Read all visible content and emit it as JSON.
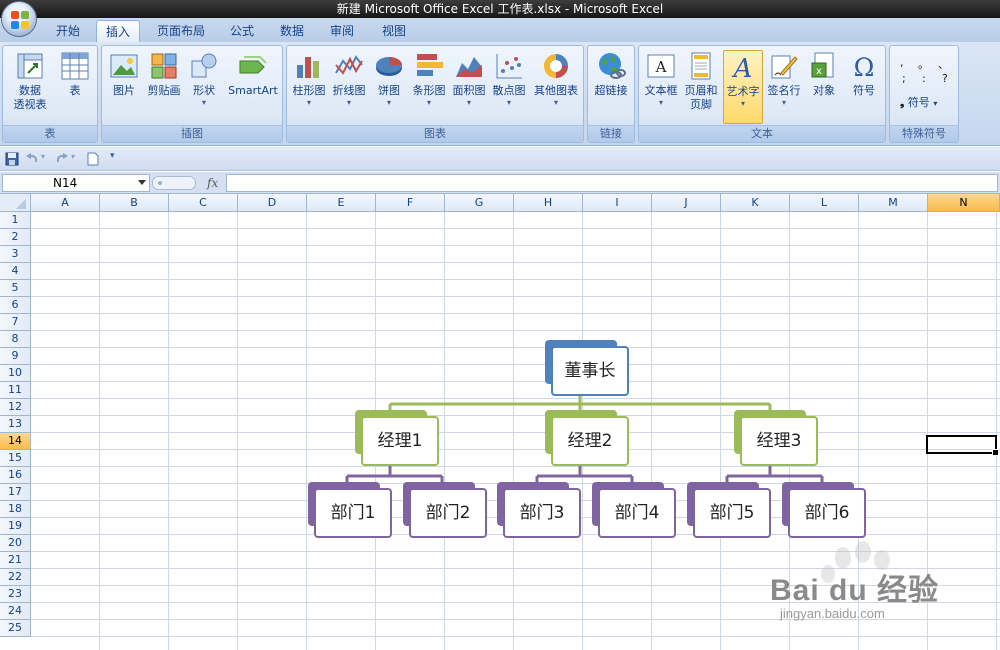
{
  "window": {
    "title": "新建 Microsoft Office Excel 工作表.xlsx - Microsoft Excel"
  },
  "tabs": [
    {
      "label": "开始",
      "active": false
    },
    {
      "label": "插入",
      "active": true
    },
    {
      "label": "页面布局",
      "active": false
    },
    {
      "label": "公式",
      "active": false
    },
    {
      "label": "数据",
      "active": false
    },
    {
      "label": "审阅",
      "active": false
    },
    {
      "label": "视图",
      "active": false
    }
  ],
  "ribbon": {
    "groups": {
      "tables": "表",
      "illustrations": "插图",
      "charts": "图表",
      "links": "链接",
      "text": "文本",
      "symbols": "特殊符号"
    },
    "buttons": {
      "pivot_line1": "数据",
      "pivot_line2": "透视表",
      "table": "表",
      "picture": "图片",
      "clipart": "剪贴画",
      "shapes": "形状",
      "smartart": "SmartArt",
      "column": "柱形图",
      "line": "折线图",
      "pie": "饼图",
      "bar": "条形图",
      "area": "面积图",
      "scatter": "散点图",
      "other_charts": "其他图表",
      "hyperlink": "超链接",
      "textbox": "文本框",
      "header_line1": "页眉和",
      "header_line2": "页脚",
      "wordart": "艺术字",
      "signature": "签名行",
      "object": "对象",
      "symbol": "符号",
      "special_symbol": "符号"
    },
    "symbol_chars": [
      ",",
      "。",
      "、",
      ";",
      ":",
      "?"
    ]
  },
  "formula_bar": {
    "name_box": "N14",
    "fx": "fx",
    "content": ""
  },
  "columns": [
    "A",
    "B",
    "C",
    "D",
    "E",
    "F",
    "G",
    "H",
    "I",
    "J",
    "K",
    "L",
    "M",
    "N"
  ],
  "rows": [
    "1",
    "2",
    "3",
    "4",
    "5",
    "6",
    "7",
    "8",
    "9",
    "10",
    "11",
    "12",
    "13",
    "14",
    "15",
    "16",
    "17",
    "18",
    "19",
    "20",
    "21",
    "22",
    "23",
    "24",
    "25"
  ],
  "selected_cell": {
    "column": "N",
    "row": "14"
  },
  "org_chart": {
    "root": "董事长",
    "managers": [
      "经理1",
      "经理2",
      "经理3"
    ],
    "departments": [
      "部门1",
      "部门2",
      "部门3",
      "部门4",
      "部门5",
      "部门6"
    ],
    "colors": {
      "root": "#4f81bd",
      "manager": "#9bbb59",
      "department": "#8064a2"
    }
  },
  "watermark": {
    "brand": "Bai du 经验",
    "url": "jingyan.baidu.com"
  }
}
